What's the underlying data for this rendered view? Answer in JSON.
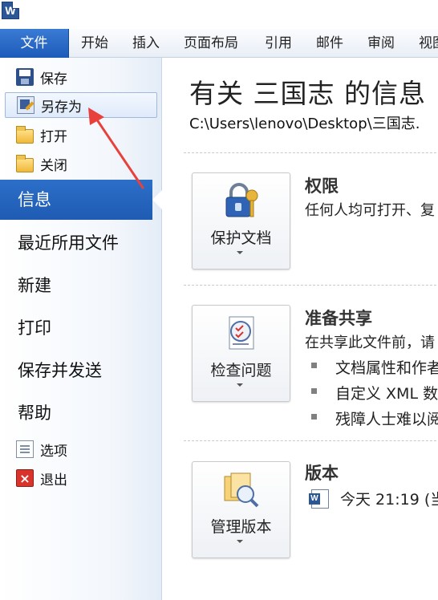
{
  "app": {
    "icon_letter": "W"
  },
  "ribbon": {
    "tabs": [
      "文件",
      "开始",
      "插入",
      "页面布局",
      "引用",
      "邮件",
      "审阅",
      "视图"
    ]
  },
  "backstage": {
    "commands": [
      {
        "label": "保存",
        "icon": "save-icon"
      },
      {
        "label": "另存为",
        "icon": "save-as-icon"
      },
      {
        "label": "打开",
        "icon": "open-folder-icon"
      },
      {
        "label": "关闭",
        "icon": "close-folder-icon"
      }
    ],
    "nav": [
      {
        "label": "信息",
        "active": true
      },
      {
        "label": "最近所用文件"
      },
      {
        "label": "新建"
      },
      {
        "label": "打印"
      },
      {
        "label": "保存并发送"
      },
      {
        "label": "帮助"
      }
    ],
    "footer": [
      {
        "label": "选项",
        "icon": "options-icon"
      },
      {
        "label": "退出",
        "icon": "exit-icon"
      }
    ]
  },
  "info": {
    "title": "有关 三国志 的信息",
    "path": "C:\\Users\\lenovo\\Desktop\\三国志.",
    "permissions": {
      "button_label": "保护文档",
      "title": "权限",
      "desc": "任何人均可打开、复"
    },
    "prepare": {
      "button_label": "检查问题",
      "title": "准备共享",
      "desc": "在共享此文件前，请",
      "bullets": [
        "文档属性和作者",
        "自定义 XML 数",
        "残障人士难以阅"
      ]
    },
    "versions": {
      "button_label": "管理版本",
      "title": "版本",
      "entry": "今天 21:19 (当"
    }
  },
  "colors": {
    "file_tab": "#1d5bb8",
    "active_nav": "#2c6fc9",
    "annotation_arrow": "#e8413c"
  }
}
